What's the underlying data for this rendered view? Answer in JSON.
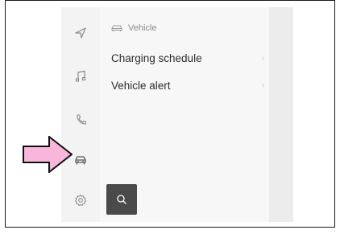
{
  "header": {
    "icon": "car-icon",
    "title": "Vehicle"
  },
  "menu": [
    {
      "label": "Charging schedule",
      "chevron": "›"
    },
    {
      "label": "Vehicle alert",
      "chevron": "›"
    }
  ],
  "rail_icons": [
    "navigation-icon",
    "music-icon",
    "phone-icon",
    "car-icon",
    "settings-icon"
  ],
  "search": {
    "icon": "search-icon"
  },
  "annotation": {
    "icon": "pointer-arrow-icon",
    "color": "#f7b6da"
  },
  "colors": {
    "search_button": "#4a4a4a",
    "panel_bg": "#f7f7f7",
    "rail_bg": "#f3f3f3"
  }
}
